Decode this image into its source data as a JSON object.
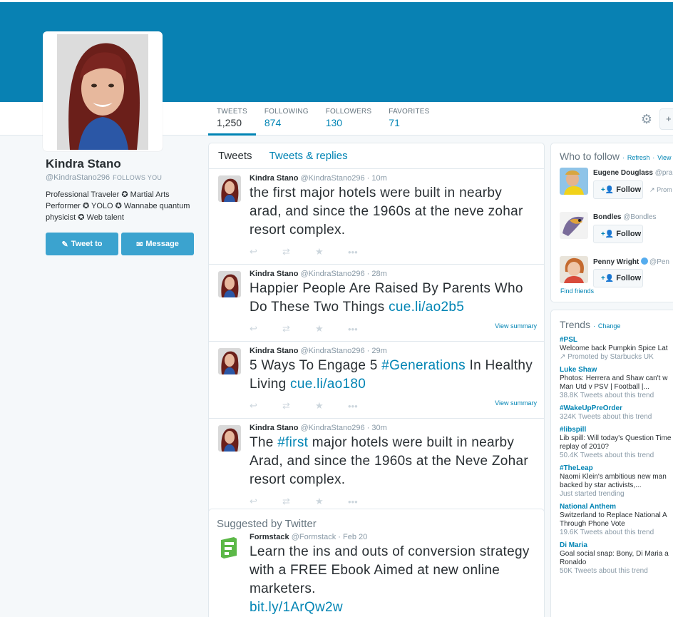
{
  "profile": {
    "name": "Kindra Stano",
    "handle": "@KindraStano296",
    "follows_you": "FOLLOWS YOU",
    "bio": "Professional Traveler ✪ Martial Arts Performer ✪ YOLO ✪ Wannabe quantum physicist ✪ Web talent",
    "tweet_to_label": "Tweet to",
    "message_label": "Message"
  },
  "stats": [
    {
      "label": "TWEETS",
      "value": "1,250"
    },
    {
      "label": "FOLLOWING",
      "value": "874"
    },
    {
      "label": "FOLLOWERS",
      "value": "130"
    },
    {
      "label": "FAVORITES",
      "value": "71"
    }
  ],
  "timeline": {
    "tabs": [
      "Tweets",
      "Tweets & replies"
    ],
    "tweets": [
      {
        "name": "Kindra Stano",
        "handle": "@KindraStano296",
        "time": "10m",
        "text": "the first major hotels were built in nearby arad, and since the 1960s at the neve zohar resort complex."
      },
      {
        "name": "Kindra Stano",
        "handle": "@KindraStano296",
        "time": "28m",
        "text": "Happier People Are Raised By Parents Who Do These Two Things ",
        "link": "cue.li/ao2b5",
        "summary": "View summary"
      },
      {
        "name": "Kindra Stano",
        "handle": "@KindraStano296",
        "time": "29m",
        "pre": "5 Ways To Engage 5 ",
        "hashtag": "#Generations",
        "post": " In Healthy Living ",
        "link": "cue.li/ao180",
        "summary": "View summary"
      },
      {
        "name": "Kindra Stano",
        "handle": "@KindraStano296",
        "time": "30m",
        "pre": "The ",
        "hashtag": "#first",
        "post": " major hotels were built in nearby Arad, and since the 1960s at the Neve Zohar resort complex."
      }
    ]
  },
  "suggested": {
    "title": "Suggested by Twitter",
    "tweet": {
      "name": "Formstack",
      "handle": "@Formstack",
      "time": "Feb 20",
      "text": "Learn the ins and outs of conversion strategy with a FREE Ebook Aimed at new online marketers.",
      "link": "bit.ly/1ArQw2w"
    }
  },
  "who_to_follow": {
    "title": "Who to follow",
    "refresh": "Refresh",
    "view": "View",
    "follow_label": "Follow",
    "find_friends": "Find friends",
    "users": [
      {
        "name": "Eugene Douglass",
        "handle": "@pra",
        "promoted": "Prom"
      },
      {
        "name": "Bondles",
        "handle": "@Bondles"
      },
      {
        "name": "Penny Wright",
        "handle": "@Pen"
      }
    ]
  },
  "trends": {
    "title": "Trends",
    "change": "Change",
    "items": [
      {
        "tag": "#PSL",
        "desc": "Welcome back Pumpkin Spice Lat",
        "count": "Promoted by Starbucks UK"
      },
      {
        "tag": "Luke Shaw",
        "desc": "Photos: Herrera and Shaw can't w",
        "desc2": "Man Utd v PSV | Football |...",
        "count": "38.8K Tweets about this trend"
      },
      {
        "tag": "#WakeUpPreOrder",
        "count": "324K Tweets about this trend"
      },
      {
        "tag": "#libspill",
        "desc": "Lib spill: Will today's Question Time",
        "desc2": "replay of 2010?",
        "count": "50.4K Tweets about this trend"
      },
      {
        "tag": "#TheLeap",
        "desc": "Naomi Klein's ambitious new man",
        "desc2": "backed by star activists,...",
        "count": "Just started trending"
      },
      {
        "tag": "National Anthem",
        "desc": "Switzerland to Replace National A",
        "desc2": "Through Phone Vote",
        "count": "19.6K Tweets about this trend"
      },
      {
        "tag": "Di Maria",
        "desc": "Goal social snap: Bony, Di Maria a",
        "desc2": "Ronaldo",
        "count": "50K Tweets about this trend"
      }
    ]
  },
  "colors": {
    "banner": "#0881b3",
    "link": "#0084b4",
    "button": "#3ba3cf"
  }
}
